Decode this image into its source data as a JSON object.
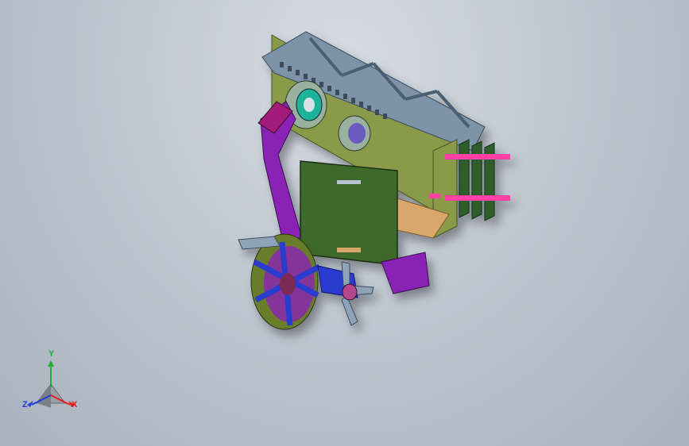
{
  "triad": {
    "y_label": "Y",
    "x_label": "X",
    "z_label": "Z",
    "colors": {
      "x": "#e11d1d",
      "y": "#1fae2b",
      "z": "#1f3fd6"
    }
  },
  "model": {
    "colors": {
      "frame": "#8a9a4a",
      "truss": "#7d93a8",
      "board": "#3e6a2c",
      "purple": "#8a22b5",
      "magenta": "#e0158c",
      "blue": "#2a3ad0",
      "wheel": "#6a7d2a",
      "pink": "#ff3fa4"
    }
  }
}
